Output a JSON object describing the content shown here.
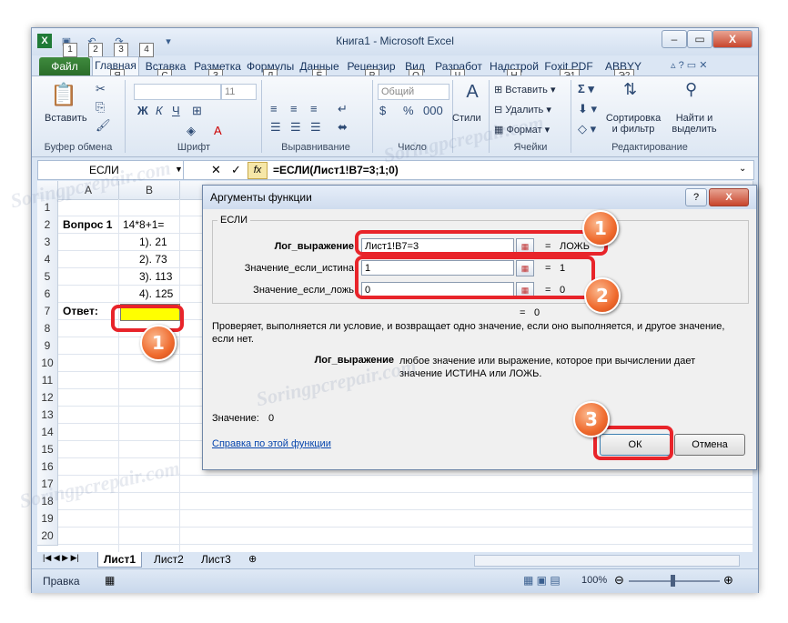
{
  "window": {
    "title": "Книга1  -  Microsoft Excel"
  },
  "qat_keytips": [
    "1",
    "2",
    "3",
    "4"
  ],
  "ribbon_tabs": [
    {
      "label": "Файл"
    },
    {
      "label": "Главная",
      "keytip": "Я"
    },
    {
      "label": "Вставка",
      "keytip": "С"
    },
    {
      "label": "Разметка",
      "keytip": "З"
    },
    {
      "label": "Формулы",
      "keytip": "Л"
    },
    {
      "label": "Данные",
      "keytip": "Ё"
    },
    {
      "label": "Рецензир",
      "keytip": "Р"
    },
    {
      "label": "Вид",
      "keytip": "О"
    },
    {
      "label": "Разработ",
      "keytip": "Ч"
    },
    {
      "label": "Надстрой",
      "keytip": "Н"
    },
    {
      "label": "Foxit PDF",
      "keytip": "Э1"
    },
    {
      "label": "ABBYY PD",
      "keytip": "Э2"
    }
  ],
  "ribbon": {
    "paste_label": "Вставить",
    "font_size": "11",
    "number_format": "Общий",
    "styles_label": "Стили",
    "insert_label": "Вставить",
    "delete_label": "Удалить",
    "format_label": "Формат",
    "sort_label_1": "Сортировка",
    "sort_label_2": "и фильтр",
    "find_label_1": "Найти и",
    "find_label_2": "выделить",
    "groups": {
      "clipboard": "Буфер обмена",
      "font": "Шрифт",
      "align": "Выравнивание",
      "number": "Число",
      "cells": "Ячейки",
      "edit": "Редактирование"
    }
  },
  "formula_bar": {
    "name_box": "ЕСЛИ",
    "fx": "fx",
    "formula": "=ЕСЛИ(Лист1!B7=3;1;0)"
  },
  "columns": [
    "A",
    "B"
  ],
  "rows": [
    "1",
    "2",
    "3",
    "4",
    "5",
    "6",
    "7",
    "8",
    "9",
    "10",
    "11",
    "12",
    "13",
    "14",
    "15",
    "16",
    "17",
    "18",
    "19",
    "20"
  ],
  "cells": {
    "a2": "Вопрос 1",
    "b2": "14*8+1=",
    "b3": "1). 21",
    "b4": "2). 73",
    "b5": "3). 113",
    "b6": "4). 125",
    "a7": "Ответ:"
  },
  "sheet_tabs": [
    "Лист1",
    "Лист2",
    "Лист3"
  ],
  "status": {
    "mode": "Правка",
    "zoom": "100%"
  },
  "dialog": {
    "title": "Аргументы функции",
    "func_name": "ЕСЛИ",
    "args": [
      {
        "label": "Лог_выражение",
        "value": "Лист1!B7=3",
        "result": "ЛОЖЬ"
      },
      {
        "label": "Значение_если_истина",
        "value": "1",
        "result": "1"
      },
      {
        "label": "Значение_если_ложь",
        "value": "0",
        "result": "0"
      }
    ],
    "total_result": "0",
    "description": "Проверяет, выполняется ли условие, и возвращает одно значение, если оно выполняется, и другое значение, если нет.",
    "arg_title": "Лог_выражение",
    "arg_desc": "любое значение или выражение, которое при вычислении дает значение ИСТИНА или ЛОЖЬ.",
    "value_label": "Значение:",
    "value": "0",
    "help_link": "Справка по этой функции",
    "ok": "ОК",
    "cancel": "Отмена",
    "help_btn": "?",
    "close_btn": "X",
    "eq": "="
  },
  "badges": [
    "1",
    "1",
    "2",
    "3"
  ],
  "watermark": "Soringpcrepair.com",
  "colors": {
    "accent_red": "#e8242a",
    "badge_orange": "#ef6a2d",
    "cell_yellow": "#ffff00",
    "file_tab_green": "#2b6d2a"
  }
}
